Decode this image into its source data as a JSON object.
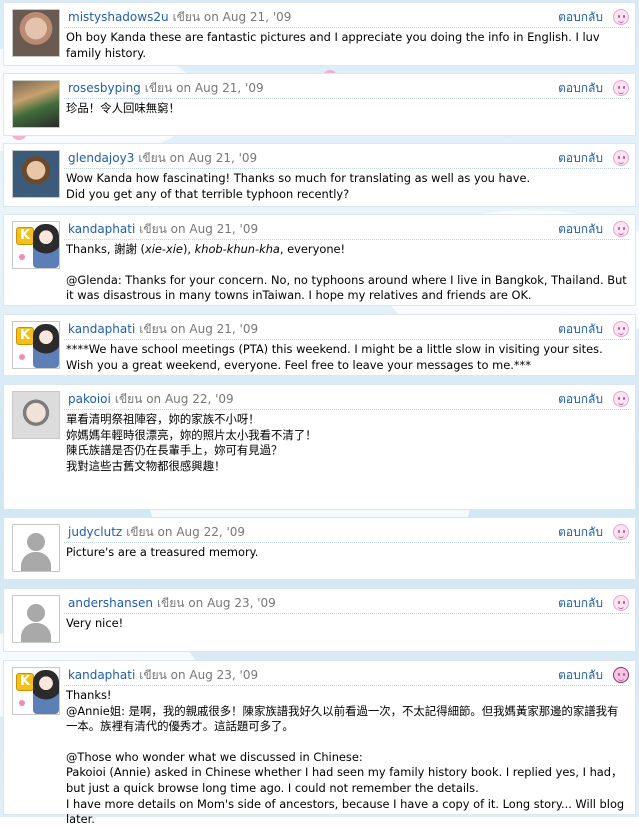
{
  "comments": [
    {
      "username": "mistyshadows2u",
      "meta": "เขียน on Aug 21, '09",
      "reply": "ตอบกลับ",
      "avatar": "photo-woman-smiling",
      "lines": [
        "Oh boy Kanda these are fantastic pictures and I appreciate you doing the info in English. I luv family history."
      ]
    },
    {
      "username": "rosesbyping",
      "meta": "เขียน on Aug 21, '09",
      "reply": "ตอบกลับ",
      "avatar": "photo-family",
      "lines": [
        "珍品！令人回味無窮！"
      ]
    },
    {
      "username": "glendajoy3",
      "meta": "เขียน on Aug 21, '09",
      "reply": "ตอบกลับ",
      "avatar": "photo-woman-portrait",
      "lines": [
        "Wow Kanda how fascinating! Thanks so much for translating as well as you have.",
        "Did you get any of that terrible typhoon recently?"
      ]
    },
    {
      "username": "kandaphati",
      "meta": "เขียน on Aug 21, '09",
      "reply": "ตอบกลับ",
      "avatar": "kanda-anime-avatar",
      "thanks_prefix": "Thanks, 謝謝 (",
      "thanks_em1": "xie-xie",
      "thanks_mid": "), ",
      "thanks_em2": "khob-khun-kha",
      "thanks_suffix": ", everyone!",
      "lines": [
        "@Glenda: Thanks for your concern. No, no typhoons around where I live in Bangkok, Thailand. But it was disastrous in many towns inTaiwan. I hope my relatives and friends are OK."
      ]
    },
    {
      "username": "kandaphati",
      "meta": "เขียน on Aug 21, '09",
      "reply": "ตอบกลับ",
      "avatar": "kanda-anime-avatar",
      "lines": [
        "****We have school meetings (PTA) this weekend. I might be a little slow in visiting your sites. Wish you a great weekend, everyone. Feel free to leave your messages to me.***"
      ]
    },
    {
      "username": "pakoioi",
      "meta": "เขียน on Aug 22, '09",
      "reply": "ตอบกลับ",
      "avatar": "photo-child",
      "lines": [
        "單看清明祭祖陣容，妳的家族不小呀！",
        "妳媽媽年輕時很漂亮，妳的照片太小我看不清了！",
        "陳氏族譜是否仍在長輩手上，妳可有見過？",
        "我對這些古舊文物都很感興趣！"
      ]
    },
    {
      "username": "judyclutz",
      "meta": "เขียน on Aug 22, '09",
      "reply": "ตอบกลับ",
      "avatar": "default-avatar",
      "lines": [
        "Picture's are a treasured memory."
      ]
    },
    {
      "username": "andershansen",
      "meta": "เขียน on Aug 23, '09",
      "reply": "ตอบกลับ",
      "avatar": "default-avatar",
      "lines": [
        "Very nice!"
      ]
    },
    {
      "username": "kandaphati",
      "meta": "เขียน on Aug 23, '09",
      "reply": "ตอบกลับ",
      "avatar": "kanda-anime-avatar",
      "lines": [
        "Thanks!",
        "@Annie姐: 是啊，我的親戚很多！陳家族譜我好久以前看過一次，不太記得細節。但我媽黃家那邊的家譜我有一本。族裡有清代的優秀才。這話題可多了。",
        "",
        "@Those who wonder what we discussed in Chinese:",
        "Pakoioi (Annie) asked in Chinese whether I had seen my family history book. I replied yes, I had， but just a quick browse long time ago. I could not remember the details.",
        "I have more details on Mom's side of ancestors, because I have a copy of it. Long story... Will blog later."
      ]
    }
  ]
}
